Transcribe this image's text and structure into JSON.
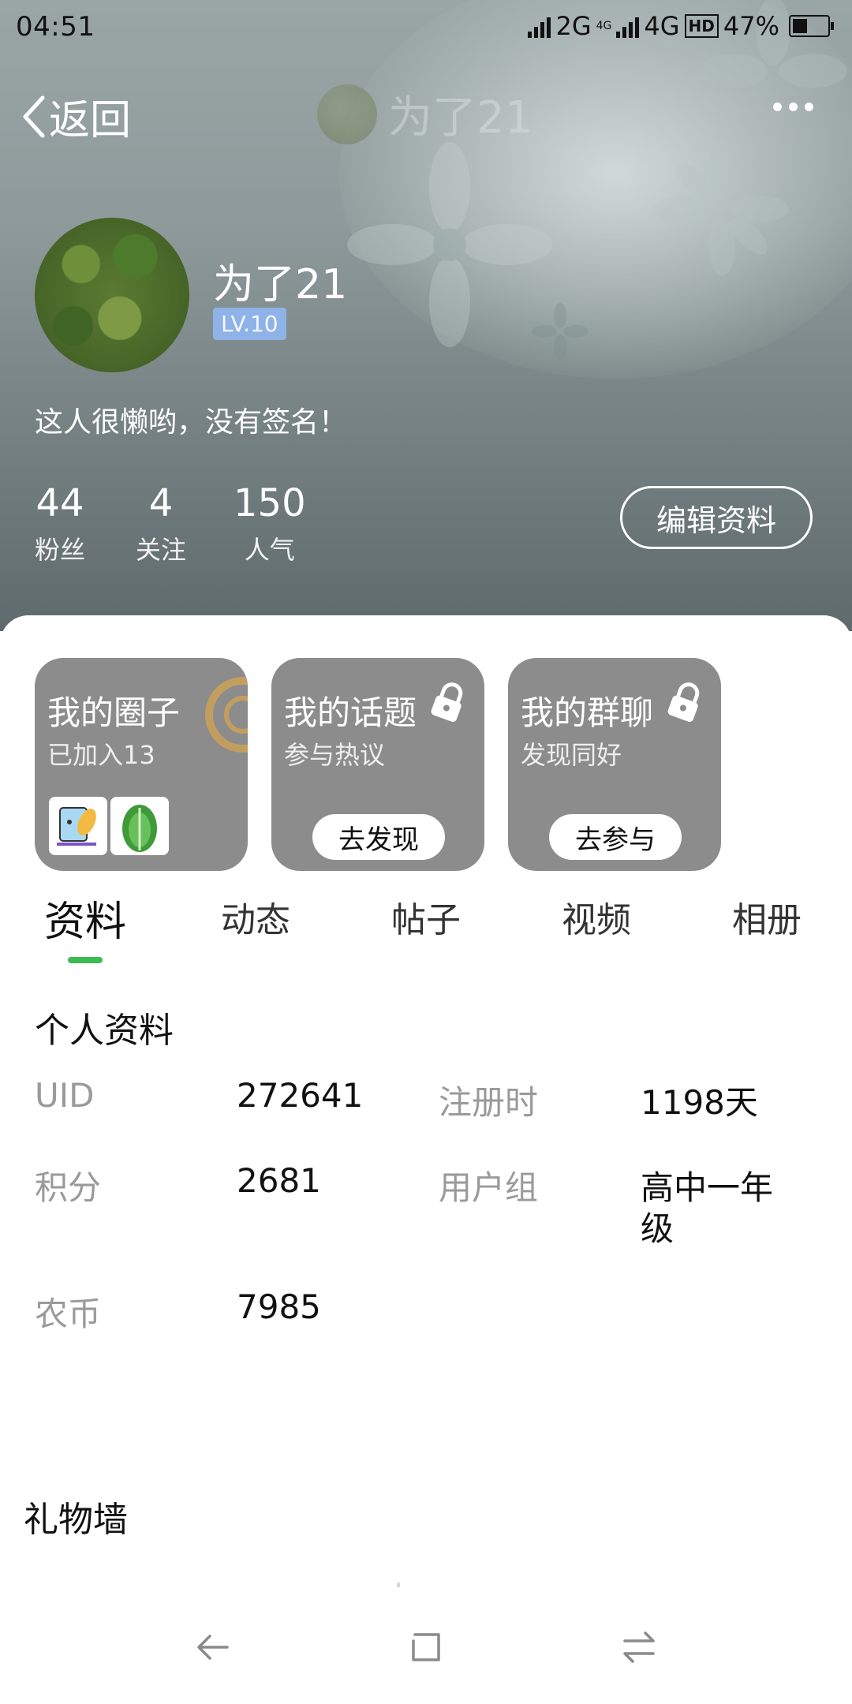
{
  "status_bar": {
    "time": "04:51",
    "network_1": "2G",
    "network_small": "4G",
    "network_2": "4G",
    "hd": "HD",
    "battery": "47%",
    "battery_level": 0.47
  },
  "nav": {
    "back_label": "返回",
    "title": "为了21"
  },
  "profile": {
    "username": "为了21",
    "level": "LV.10",
    "signature": "这人很懒哟，没有签名！",
    "stats": [
      {
        "value": "44",
        "label": "粉丝"
      },
      {
        "value": "4",
        "label": "关注"
      },
      {
        "value": "150",
        "label": "人气"
      }
    ],
    "edit_button": "编辑资料"
  },
  "cards": [
    {
      "title": "我的圈子",
      "subtitle": "已加入13"
    },
    {
      "title": "我的话题",
      "subtitle": "参与热议",
      "button": "去发现"
    },
    {
      "title": "我的群聊",
      "subtitle": "发现同好",
      "button": "去参与"
    }
  ],
  "tabs": [
    "资料",
    "动态",
    "帖子",
    "视频",
    "相册"
  ],
  "active_tab": "资料",
  "personal_info": {
    "title": "个人资料",
    "rows": [
      {
        "label": "UID",
        "value": "272641"
      },
      {
        "label": "注册时",
        "value": "1198天"
      },
      {
        "label": "积分",
        "value": "2681"
      },
      {
        "label": "用户组",
        "value_line1": "高中一年",
        "value_line2": "级"
      },
      {
        "label": "农币",
        "value": "7985"
      }
    ]
  },
  "gift_wall": {
    "title": "礼物墙"
  },
  "colors": {
    "accent_green": "#3dbb54",
    "level_badge": "#8fb3e8",
    "card_gray": "#8c8c8c"
  }
}
